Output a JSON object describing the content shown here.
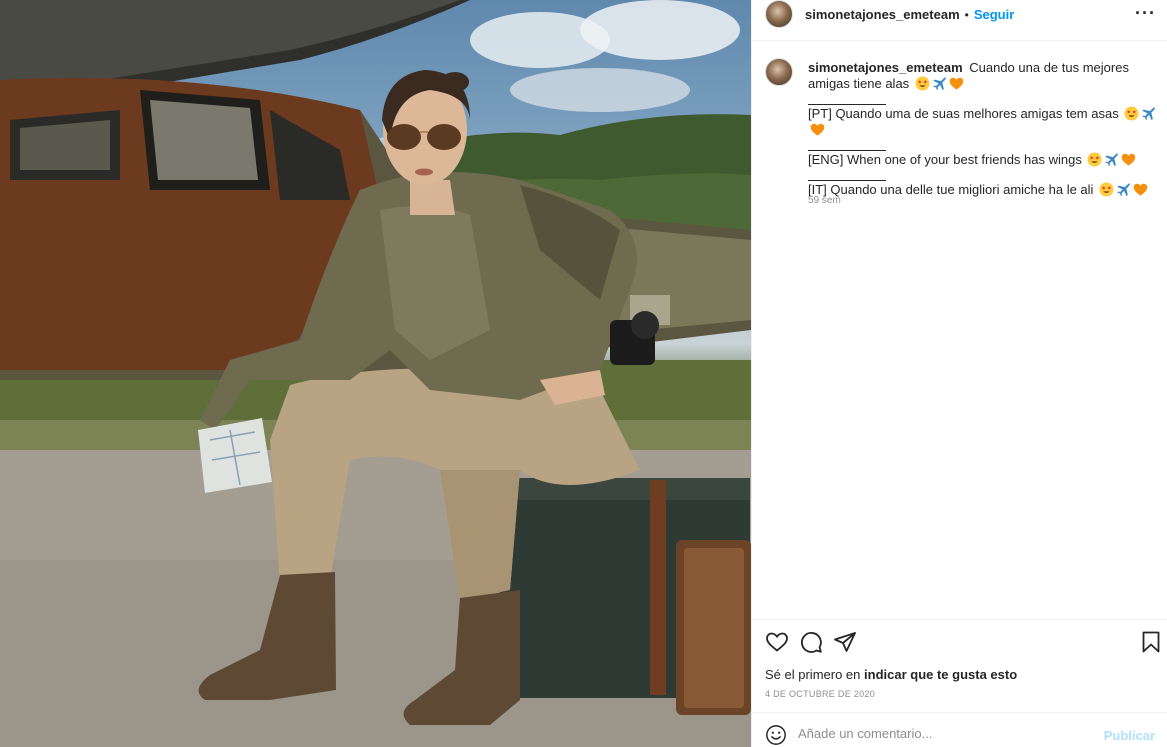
{
  "post": {
    "image_alt": "",
    "header": {
      "username": "simonetajones_emeteam",
      "separator": "•",
      "follow_label": "Seguir",
      "more_icon": "more-horizontal-icon"
    },
    "caption": {
      "username": "simonetajones_emeteam",
      "text": "Cuando una de tus mejores amigas tiene alas",
      "translations": [
        {
          "text": "[PT] Quando uma de suas melhores amigas tem asas"
        },
        {
          "text": "[ENG] When one of your best friends has wings"
        },
        {
          "text": "[IT] Quando una delle tue migliori amiche ha le ali"
        }
      ],
      "emojis": [
        "star-struck-emoji",
        "airplane-emoji",
        "orange-heart-emoji"
      ],
      "time_ago": "59 sem"
    },
    "actions": {
      "like_icon": "heart-icon",
      "comment_icon": "comment-icon",
      "share_icon": "send-icon",
      "save_icon": "bookmark-icon"
    },
    "likes": {
      "prefix": "Sé el primero en",
      "link": "indicar que te gusta esto"
    },
    "date": "4 DE OCTUBRE DE 2020",
    "comment": {
      "emoji_icon": "smiley-icon",
      "placeholder": "Añade un comentario...",
      "publish_label": "Publicar"
    }
  },
  "colors": {
    "link_blue": "#0095f6",
    "publish_disabled": "#b2dffc",
    "muted_text": "#8e8e8e",
    "divider": "#efefef"
  }
}
